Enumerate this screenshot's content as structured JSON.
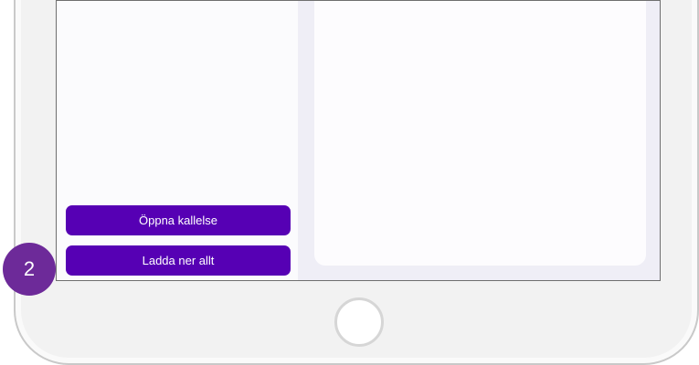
{
  "left_pane": {
    "open_button_label": "Öppna kallelse",
    "download_button_label": "Ladda ner allt"
  },
  "annotation": {
    "step_number": "2"
  },
  "colors": {
    "accent": "#5600b4",
    "badge": "#6d2a99"
  }
}
